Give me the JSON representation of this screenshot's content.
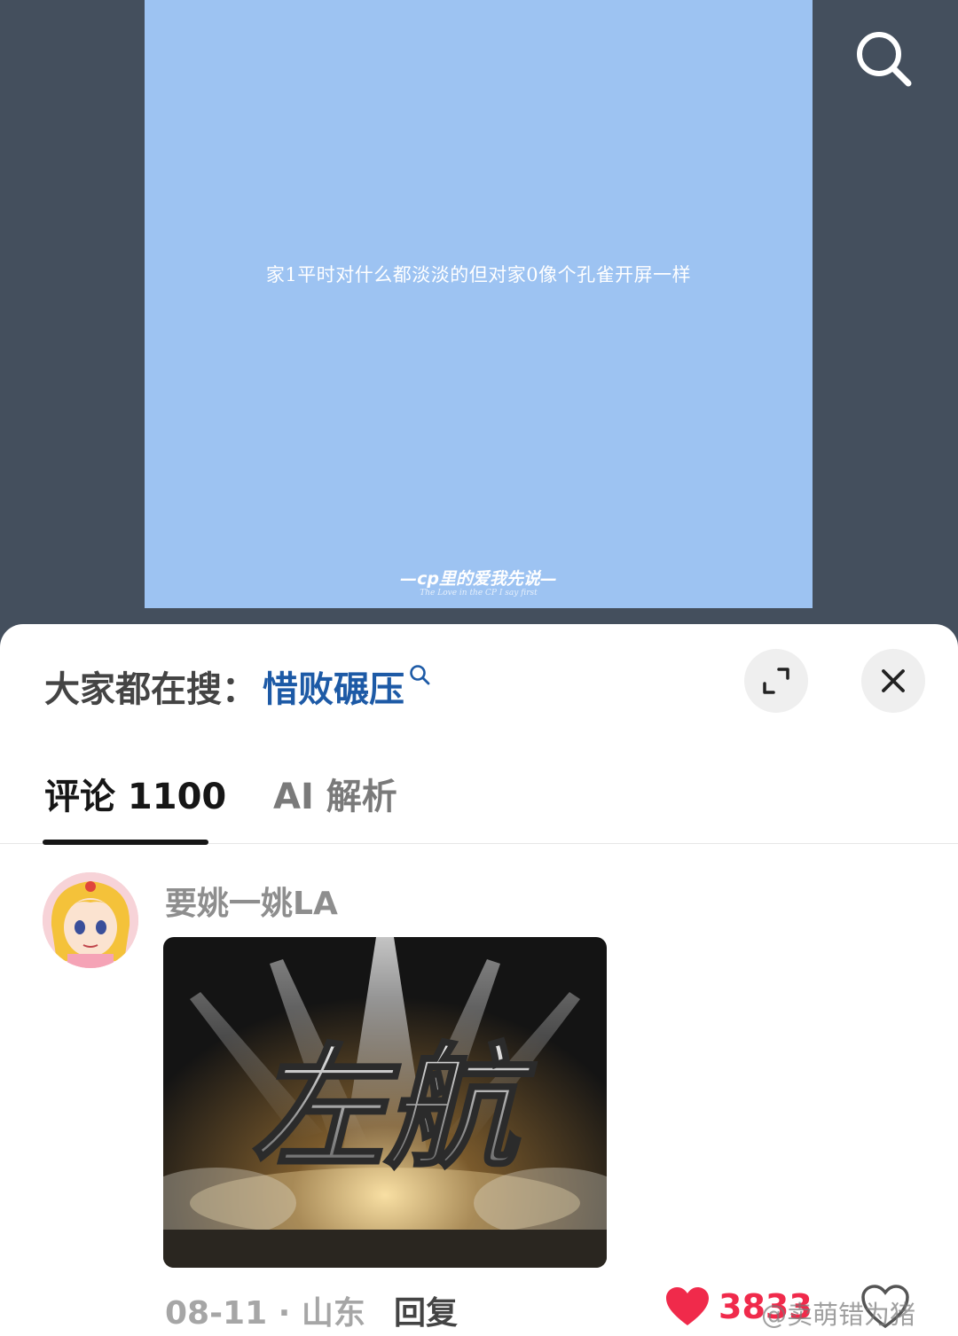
{
  "video": {
    "caption": "家1平时对什么都淡淡的但对家0像个孔雀开屏一样",
    "watermark": "—cp里的爱我先说—",
    "watermark_sub": "The Love in the CP I say first"
  },
  "sheet": {
    "trending_prefix": "大家都在搜：",
    "trending_term": "惜败碾压"
  },
  "tabs": [
    {
      "label": "评论 1100",
      "active": true
    },
    {
      "label": "AI 解析",
      "active": false
    }
  ],
  "comment": {
    "username": "要姚一姚LA",
    "image_text": "左航",
    "date_location": "08-11 · 山东",
    "reply_label": "回复",
    "like_count": "3833"
  },
  "watermark": "@卖萌错为猪",
  "colors": {
    "video_bg": "#444f5d",
    "video_frame": "#9dc3f2",
    "trending_term": "#1d5aa6",
    "like": "#f02a4b"
  }
}
